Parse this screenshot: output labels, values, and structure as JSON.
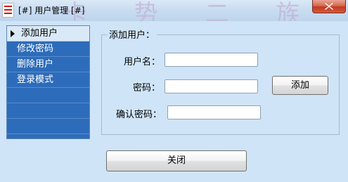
{
  "window": {
    "title": "[#] 用户管理 [#]",
    "app_icon": "app-icon",
    "close_icon": "close-icon",
    "decoration_text": "卡 势 二 族"
  },
  "sidebar": {
    "items": [
      {
        "label": "添加用户",
        "active": true
      },
      {
        "label": "修改密码",
        "active": false
      },
      {
        "label": "删除用户",
        "active": false
      },
      {
        "label": "登录模式",
        "active": false
      },
      {
        "label": "",
        "active": false
      },
      {
        "label": "",
        "active": false
      },
      {
        "label": "",
        "active": false
      }
    ]
  },
  "form": {
    "legend": "添加用户：",
    "username_label": "用户名：",
    "username_value": "",
    "password_label": "密码：",
    "password_value": "",
    "confirm_label": "确认密码：",
    "confirm_value": "",
    "add_button": "添加"
  },
  "footer": {
    "close_button": "关闭"
  },
  "colors": {
    "sidebar_bg": "#2d6cba",
    "active_item_bg": "#d9e9f8",
    "window_bg": "#cfe4f6",
    "close_btn": "#c23a20"
  }
}
